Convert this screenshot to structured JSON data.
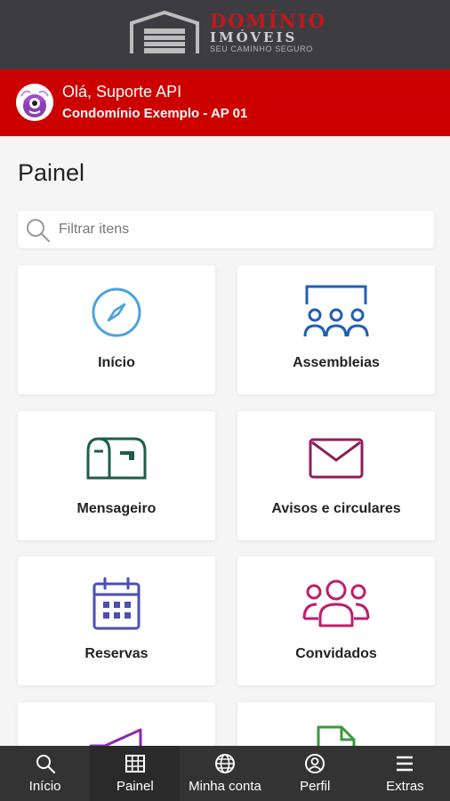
{
  "header": {
    "logo": {
      "name": "DOMÍNIO",
      "subtitle": "IMÓVEIS",
      "tagline": "SEU CAMINHO SEGURO"
    }
  },
  "user": {
    "greeting": "Olá, Suporte API",
    "condo": "Condomínio Exemplo - AP 01"
  },
  "page": {
    "title": "Painel",
    "search_placeholder": "Filtrar itens"
  },
  "cards": [
    {
      "label": "Início",
      "icon": "compass-icon",
      "color": "#4aa3df"
    },
    {
      "label": "Assembleias",
      "icon": "assembly-icon",
      "color": "#1f5fb7"
    },
    {
      "label": "Mensageiro",
      "icon": "mailbox-icon",
      "color": "#1d5e4d"
    },
    {
      "label": "Avisos e circulares",
      "icon": "envelope-icon",
      "color": "#8d1f5a"
    },
    {
      "label": "Reservas",
      "icon": "calendar-icon",
      "color": "#4a4fb5"
    },
    {
      "label": "Convidados",
      "icon": "guests-icon",
      "color": "#c21b6c"
    },
    {
      "label": "",
      "icon": "megaphone-icon",
      "color": "#8e27b0"
    },
    {
      "label": "",
      "icon": "document-icon",
      "color": "#3a9a3a"
    }
  ],
  "nav": [
    {
      "label": "Início",
      "icon": "search-icon"
    },
    {
      "label": "Painel",
      "icon": "grid-icon",
      "active": true
    },
    {
      "label": "Minha conta",
      "icon": "globe-icon"
    },
    {
      "label": "Perfil",
      "icon": "user-circle-icon"
    },
    {
      "label": "Extras",
      "icon": "menu-icon"
    }
  ],
  "colors": {
    "topbar": "#3d3d41",
    "userbar": "#cd0000",
    "brand_red": "#c4161c",
    "nav_bg": "#333333"
  }
}
